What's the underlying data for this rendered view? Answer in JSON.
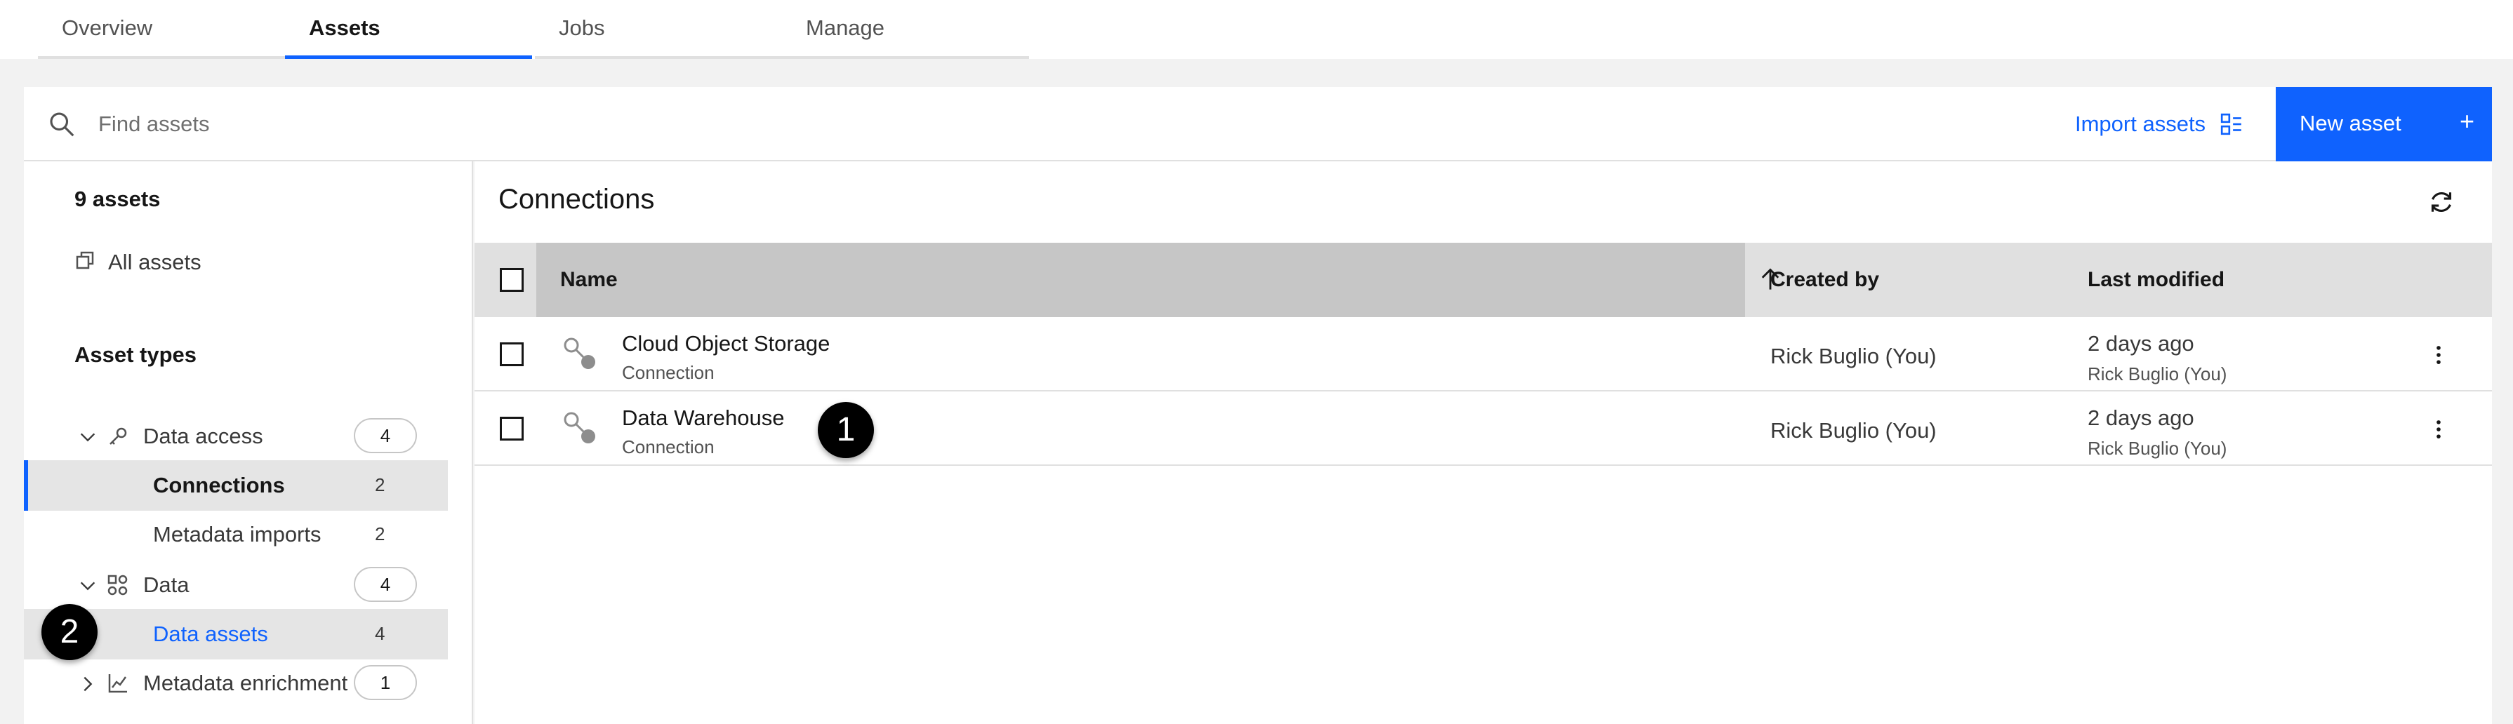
{
  "tabs": [
    {
      "label": "Overview"
    },
    {
      "label": "Assets"
    },
    {
      "label": "Jobs"
    },
    {
      "label": "Manage"
    }
  ],
  "toolbar": {
    "search_placeholder": "Find assets",
    "import_label": "Import assets",
    "new_asset_label": "New asset",
    "new_asset_icon": "+"
  },
  "sidebar": {
    "asset_count": "9 assets",
    "all_assets": "All assets",
    "asset_types_heading": "Asset types",
    "groups": [
      {
        "label": "Data access",
        "count": "4",
        "icon": "key-icon",
        "expanded": true,
        "items": [
          {
            "label": "Connections",
            "count": "2",
            "selected": true
          },
          {
            "label": "Metadata imports",
            "count": "2",
            "selected": false
          }
        ]
      },
      {
        "label": "Data",
        "count": "4",
        "icon": "data-icon",
        "expanded": true,
        "items": [
          {
            "label": "Data assets",
            "count": "4",
            "selected": false
          }
        ]
      },
      {
        "label": "Metadata enrichment",
        "count": "1",
        "icon": "chart-icon",
        "expanded": false,
        "items": []
      }
    ]
  },
  "main": {
    "title": "Connections",
    "columns": [
      "Name",
      "Created by",
      "Last modified"
    ],
    "rows": [
      {
        "name": "Cloud Object Storage",
        "type": "Connection",
        "created_by": "Rick Buglio (You)",
        "modified": "2 days ago",
        "modified_by": "Rick Buglio (You)"
      },
      {
        "name": "Data Warehouse",
        "type": "Connection",
        "created_by": "Rick Buglio (You)",
        "modified": "2 days ago",
        "modified_by": "Rick Buglio (You)"
      }
    ]
  },
  "callouts": [
    "1",
    "2"
  ],
  "colors": {
    "accent": "#0f62fe",
    "selected_row": "#e5e5e5",
    "header": "#e0e0e0",
    "header_sorted": "#c6c6c6"
  }
}
